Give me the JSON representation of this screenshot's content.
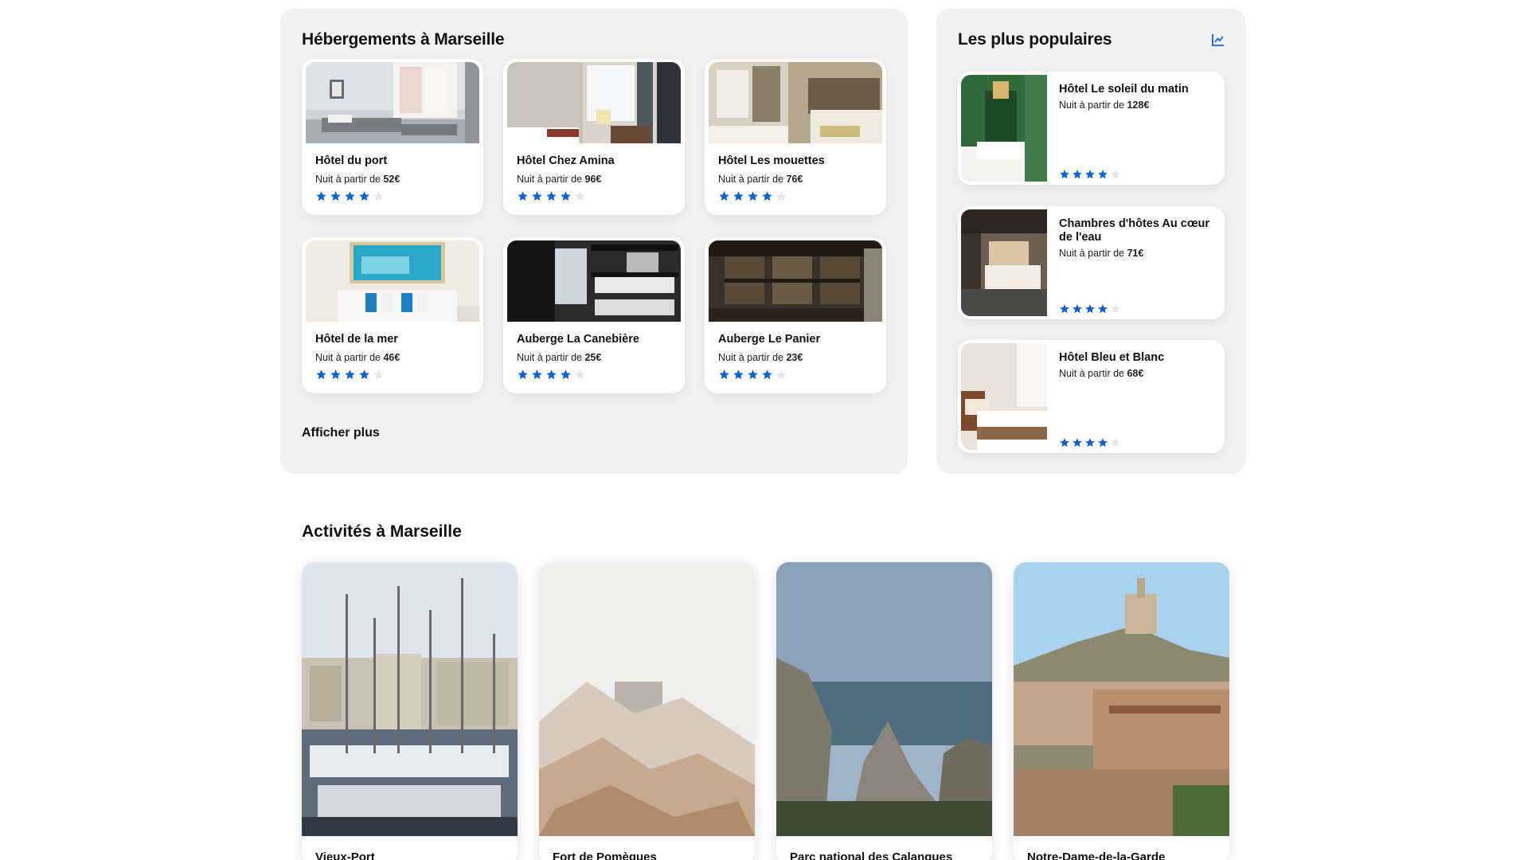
{
  "colors": {
    "accent": "#0a64d8",
    "star_empty": "#e6e6e6",
    "panel_bg": "#f2f2f2"
  },
  "hotels_section": {
    "title": "Hébergements à Marseille",
    "show_more": "Afficher plus",
    "hotels": [
      {
        "name": "Hôtel du port",
        "price_prefix": "Nuit à partir de ",
        "price": "52€",
        "rating": 4,
        "max_rating": 5
      },
      {
        "name": "Hôtel Chez Amina",
        "price_prefix": "Nuit à partir de ",
        "price": "96€",
        "rating": 4,
        "max_rating": 5
      },
      {
        "name": "Hôtel Les mouettes",
        "price_prefix": "Nuit à partir de ",
        "price": "76€",
        "rating": 4,
        "max_rating": 5
      },
      {
        "name": "Hôtel de la mer",
        "price_prefix": "Nuit à partir de ",
        "price": "46€",
        "rating": 4,
        "max_rating": 5
      },
      {
        "name": "Auberge La Canebière",
        "price_prefix": "Nuit à partir de ",
        "price": "25€",
        "rating": 4,
        "max_rating": 5
      },
      {
        "name": "Auberge Le Panier",
        "price_prefix": "Nuit à partir de ",
        "price": "23€",
        "rating": 4,
        "max_rating": 5
      }
    ]
  },
  "popular_section": {
    "title": "Les plus populaires",
    "icon": "trending-chart-icon",
    "items": [
      {
        "name": "Hôtel Le soleil du matin",
        "price_prefix": "Nuit à partir de ",
        "price": "128€",
        "rating": 4,
        "max_rating": 5
      },
      {
        "name": "Chambres d'hôtes Au cœur de l'eau",
        "price_prefix": "Nuit à partir de ",
        "price": "71€",
        "rating": 4,
        "max_rating": 5
      },
      {
        "name": "Hôtel Bleu et Blanc",
        "price_prefix": "Nuit à partir de ",
        "price": "68€",
        "rating": 4,
        "max_rating": 5
      }
    ]
  },
  "activities_section": {
    "title": "Activités à Marseille",
    "items": [
      {
        "name": "Vieux-Port"
      },
      {
        "name": "Fort de Pomègues"
      },
      {
        "name": "Parc national des Calanques"
      },
      {
        "name": "Notre-Dame-de-la-Garde"
      }
    ]
  }
}
